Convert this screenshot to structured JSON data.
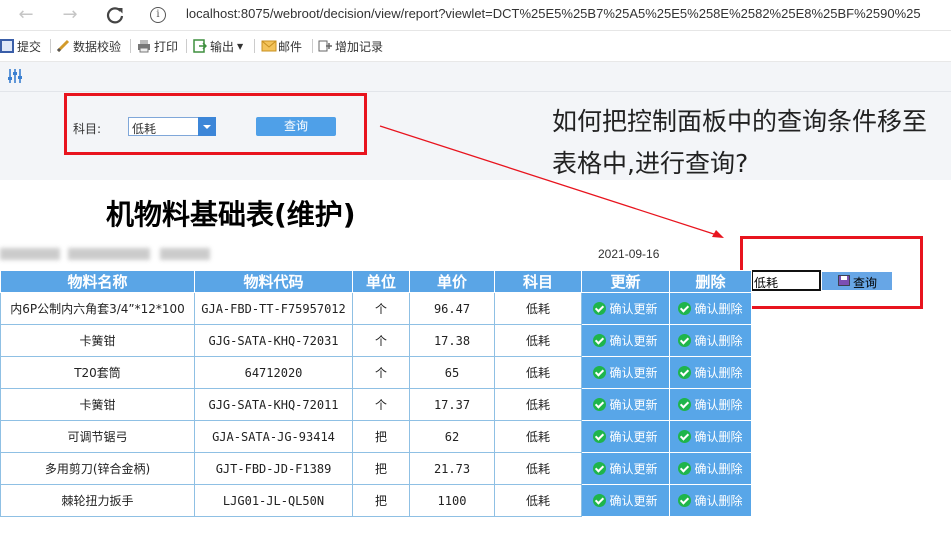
{
  "browser": {
    "url": "localhost:8075/webroot/decision/view/report?viewlet=DCT%25E5%25B7%25A5%25E5%258E%2582%25E8%25BF%2590%25"
  },
  "toolbar": {
    "items": [
      {
        "label": "提交",
        "icon": "submit-icon"
      },
      {
        "label": "数据校验",
        "icon": "verify-icon"
      },
      {
        "label": "打印",
        "icon": "print-icon"
      },
      {
        "label": "输出",
        "icon": "export-icon"
      },
      {
        "label": "邮件",
        "icon": "mail-icon"
      },
      {
        "label": "增加记录",
        "icon": "add-record-icon"
      }
    ]
  },
  "control_panel": {
    "field_label": "科目:",
    "field_value": "低耗",
    "query_label": "查询"
  },
  "annotation": {
    "question": "如何把控制面板中的查询条件移至表格中,进行查询?",
    "accent_color": "#e8141e"
  },
  "report": {
    "title": "机物料基础表(维护)",
    "date": "2021-09-16",
    "inline_query": {
      "value": "低耗",
      "label": "查询"
    },
    "columns": [
      "物料名称",
      "物料代码",
      "单位",
      "单价",
      "科目",
      "更新",
      "删除"
    ],
    "rows": [
      {
        "name": "内6P公制内六角套3/4”*12*100",
        "code": "GJA-FBD-TT-F75957012",
        "unit": "个",
        "price": "96.47",
        "subject": "低耗",
        "update": "确认更新",
        "delete": "确认删除"
      },
      {
        "name": "卡簧钳",
        "code": "GJG-SATA-KHQ-72031",
        "unit": "个",
        "price": "17.38",
        "subject": "低耗",
        "update": "确认更新",
        "delete": "确认删除"
      },
      {
        "name": "T20套筒",
        "code": "64712020",
        "unit": "个",
        "price": "65",
        "subject": "低耗",
        "update": "确认更新",
        "delete": "确认删除"
      },
      {
        "name": "卡簧钳",
        "code": "GJG-SATA-KHQ-72011",
        "unit": "个",
        "price": "17.37",
        "subject": "低耗",
        "update": "确认更新",
        "delete": "确认删除"
      },
      {
        "name": "可调节锯弓",
        "code": "GJA-SATA-JG-93414",
        "unit": "把",
        "price": "62",
        "subject": "低耗",
        "update": "确认更新",
        "delete": "确认删除"
      },
      {
        "name": "多用剪刀(锌合金柄)",
        "code": "GJT-FBD-JD-F1389",
        "unit": "把",
        "price": "21.73",
        "subject": "低耗",
        "update": "确认更新",
        "delete": "确认删除"
      },
      {
        "name": "棘轮扭力扳手",
        "code": "LJG01-JL-QL50N",
        "unit": "把",
        "price": "1100",
        "subject": "低耗",
        "update": "确认更新",
        "delete": "确认删除"
      }
    ]
  }
}
